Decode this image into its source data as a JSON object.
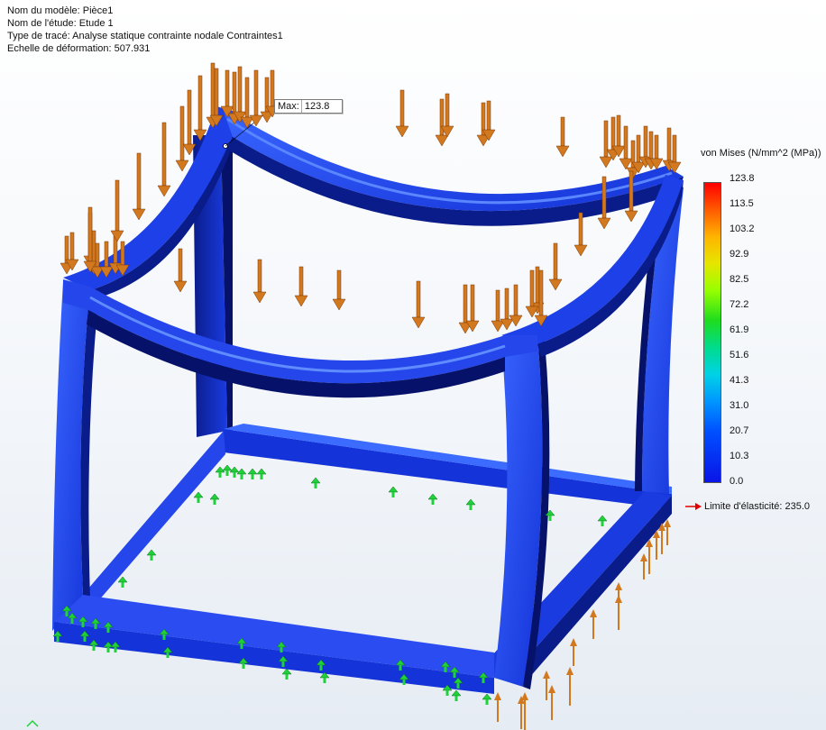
{
  "info": {
    "model_name": "Nom du modèle: Pièce1",
    "study_name": "Nom de l'étude: Etude 1",
    "plot_type": "Type de tracé: Analyse statique contrainte nodale Contraintes1",
    "deformation_scale": "Echelle de déformation: 507.931"
  },
  "max_probe": {
    "label": "Max:",
    "value": "123.8"
  },
  "legend": {
    "title": "von Mises (N/mm^2 (MPa))",
    "ticks": [
      "123.8",
      "113.5",
      "103.2",
      "92.9",
      "82.5",
      "72.2",
      "61.9",
      "51.6",
      "41.3",
      "31.0",
      "20.7",
      "10.3",
      "0.0"
    ],
    "yield_label": "Limite d'élasticité: 235.0"
  },
  "colors": {
    "beam": "#1433d8",
    "beam_dark": "#06126a",
    "beam_light": "#3c6cff",
    "load_arrow": "#d2781e",
    "fixture": "#1fd23a",
    "yield_arrow": "#e00000"
  },
  "icons": [
    "load-arrow-icon",
    "fixture-icon",
    "yield-arrow-icon"
  ]
}
